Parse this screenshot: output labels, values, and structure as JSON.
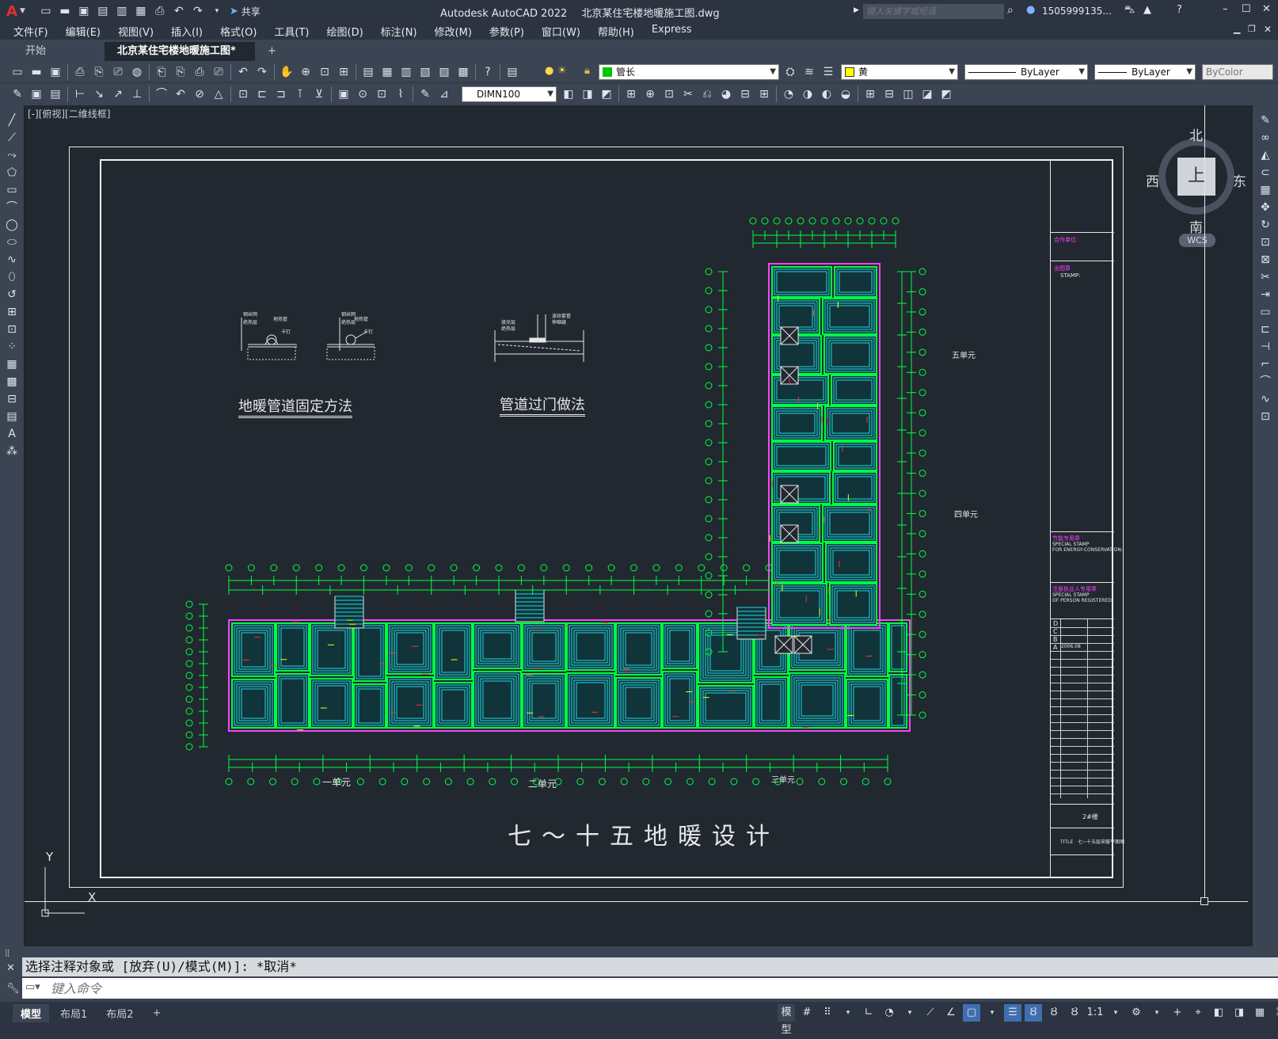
{
  "app": {
    "title": "Autodesk AutoCAD 2022",
    "file_title": "北京某住宅楼地暖施工图.dwg",
    "search_placeholder": "键入关键字或短语",
    "user": "1505999135...",
    "share_label": "共享"
  },
  "menu": [
    "文件(F)",
    "编辑(E)",
    "视图(V)",
    "插入(I)",
    "格式(O)",
    "工具(T)",
    "绘图(D)",
    "标注(N)",
    "修改(M)",
    "参数(P)",
    "窗口(W)",
    "帮助(H)",
    "Express"
  ],
  "tabs": {
    "start": "开始",
    "active": "北京某住宅楼地暖施工图*",
    "close": "×",
    "add": "+"
  },
  "toolbar": {
    "layer_name": "管长",
    "layer_color": "#00c800",
    "color_name": "黄",
    "color_swatch": "#ffff00",
    "linetype1": "ByLayer",
    "linetype2": "ByLayer",
    "plotstyle": "ByColor",
    "dimstyle": "DIMN100"
  },
  "viewport_label": "[-][俯视][二维线框]",
  "viewcube": {
    "north": "北",
    "south": "南",
    "east": "东",
    "west": "西",
    "top": "上",
    "wcs": "WCS"
  },
  "drawing": {
    "detail1_title": "地暖管道固定方法",
    "detail2_title": "管道过门做法",
    "main_title": "七～十五地暖设计",
    "unit1": "一单元",
    "unit2": "二单元",
    "unit3": "三单元",
    "unit4": "四单元",
    "unit5": "五单元",
    "tb_partner": "合作单位:",
    "tb_stamp": "出图章",
    "tb_stamp_en": "STAMP:",
    "tb_energy": "节能专用章",
    "tb_energy_en1": "SPECIAL STAMP",
    "tb_energy_en2": "FOR ENERGY-CONSERVATION:",
    "tb_reg": "注册执业人专用章",
    "tb_reg_en1": "SPECIAL STAMP",
    "tb_reg_en2": "OF PERSON REGISTERED:",
    "tb_rev": [
      "D",
      "C",
      "B",
      "A"
    ],
    "tb_date": "2006.08",
    "tb_num": "2#楼",
    "tb_title_en": "TITLE",
    "tb_title_cn": "七~十五层采暖平面图"
  },
  "ucs": {
    "x": "X",
    "y": "Y"
  },
  "command": {
    "history": "选择注释对象或 [放弃(U)/模式(M)]: *取消*",
    "placeholder": "键入命令"
  },
  "layouts": [
    "模型",
    "布局1",
    "布局2"
  ],
  "status": {
    "model": "模型",
    "scale": "1:1"
  }
}
